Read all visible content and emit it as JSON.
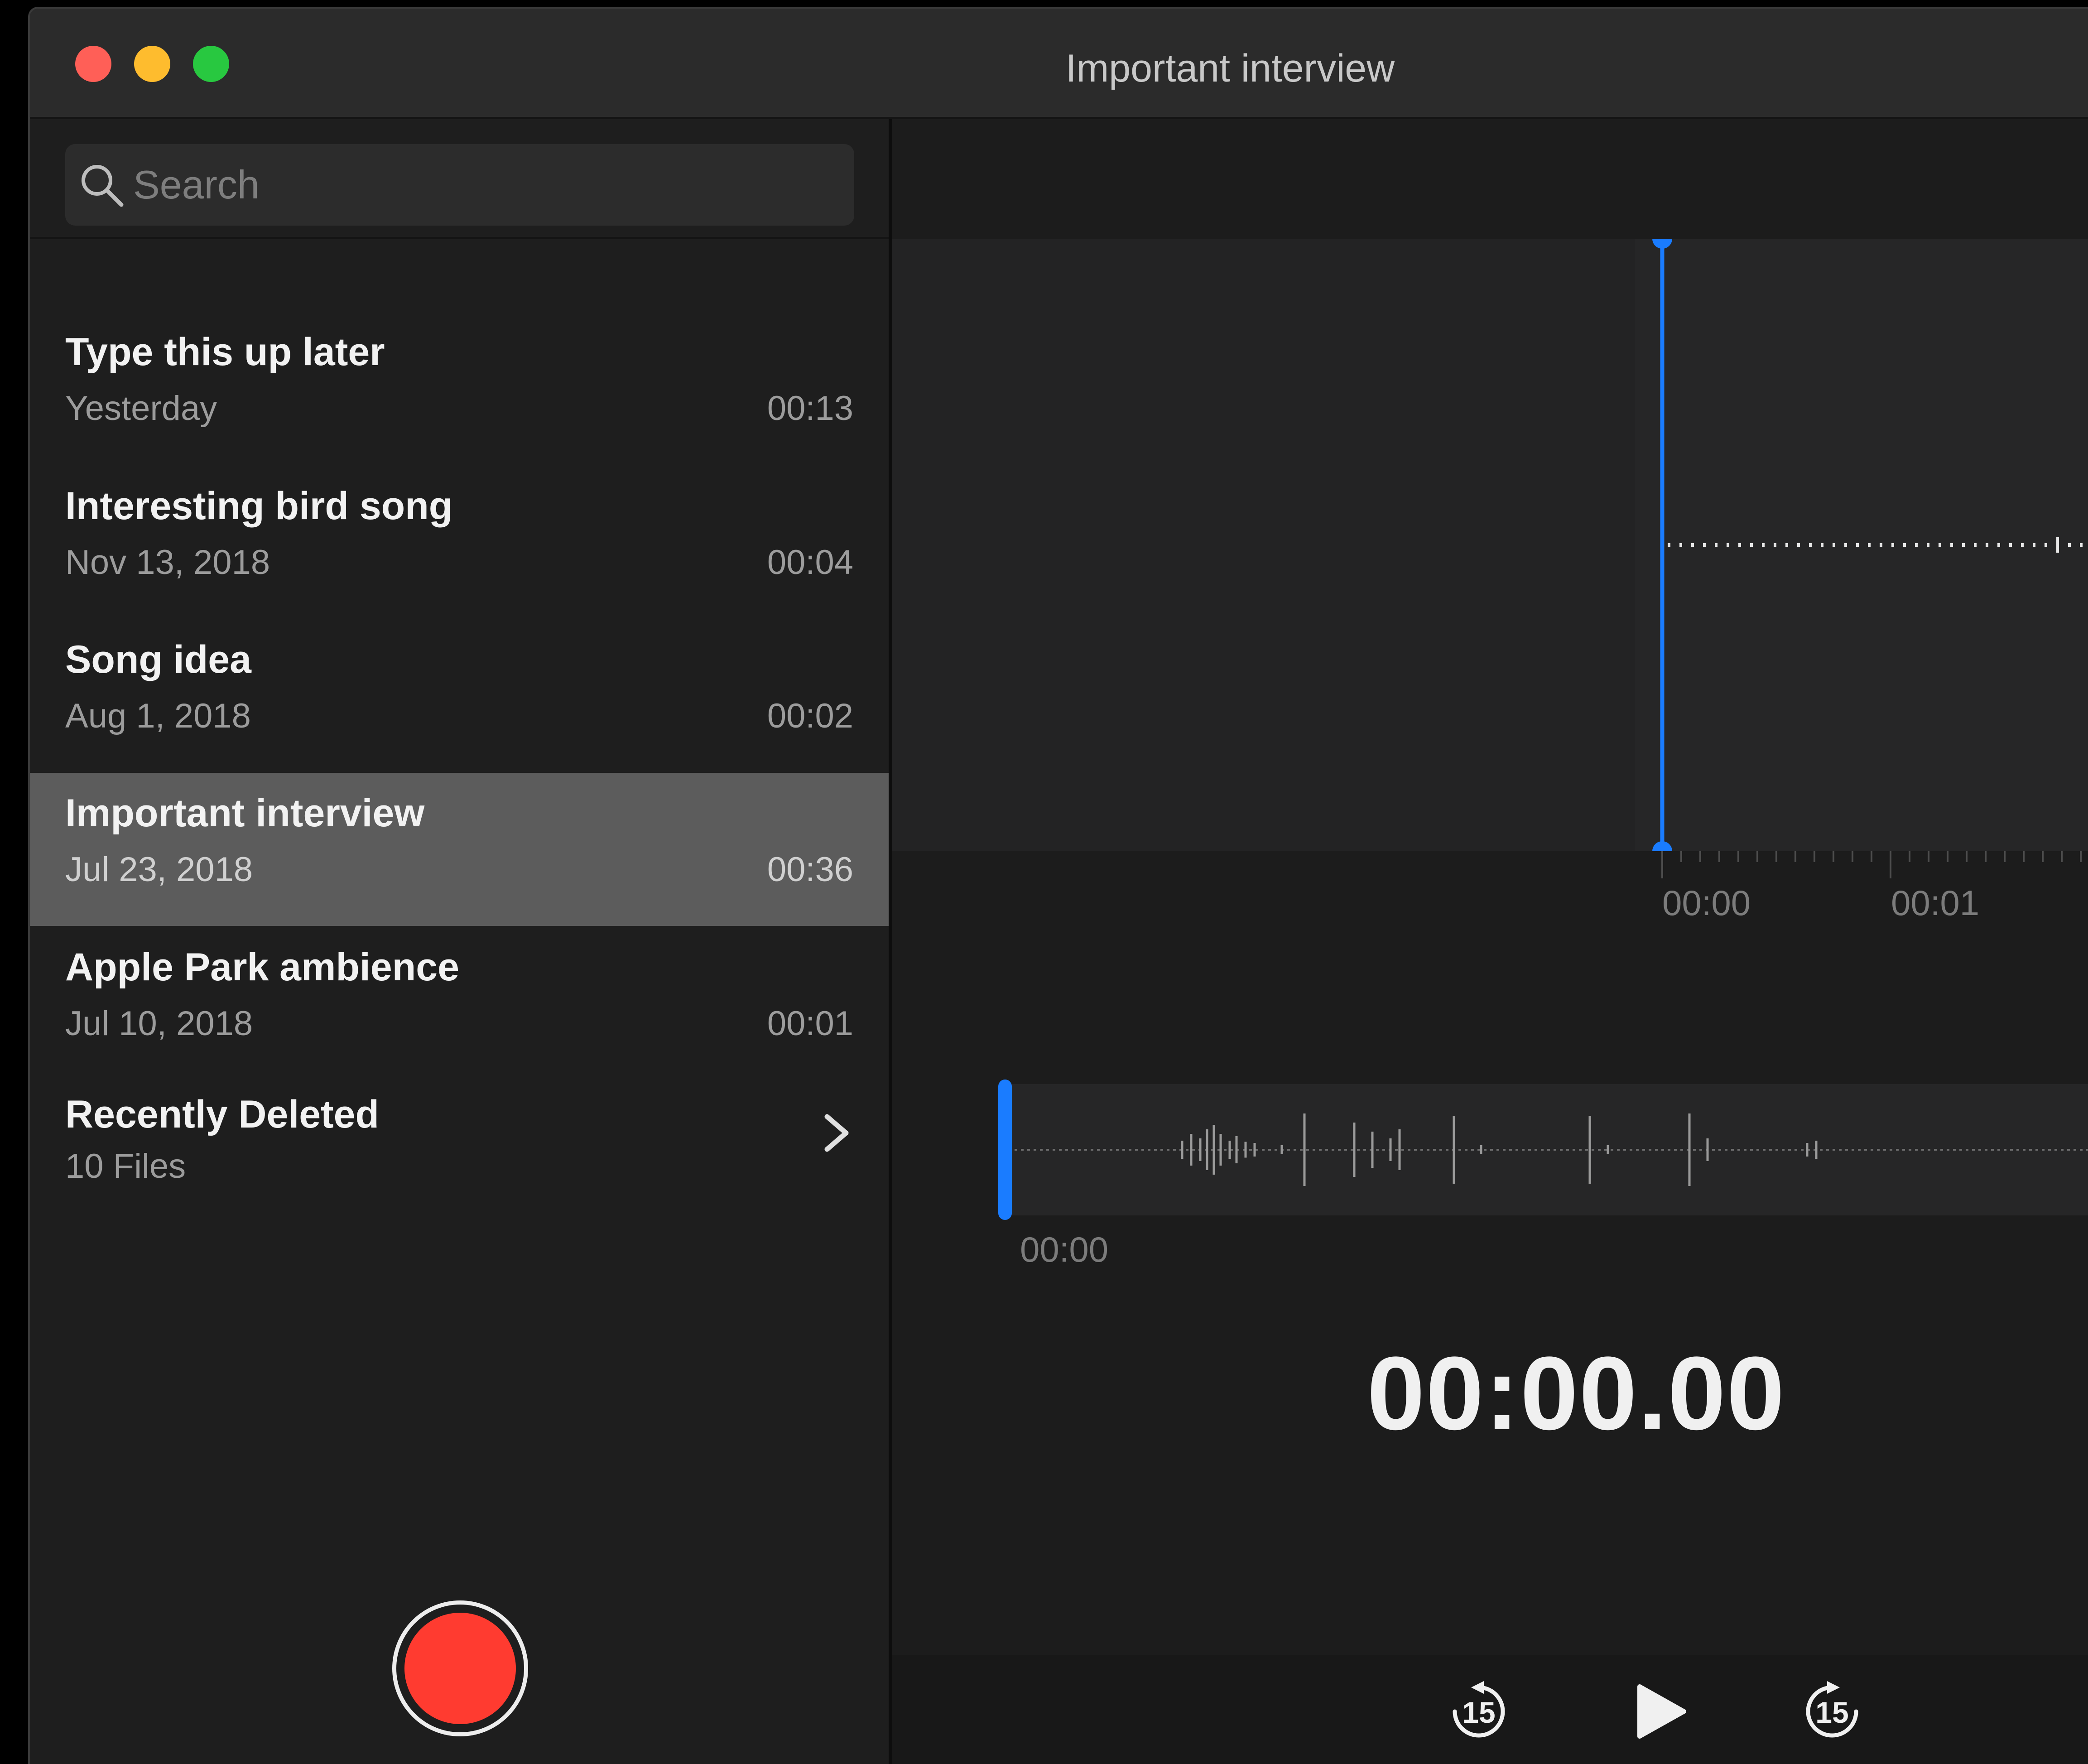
{
  "window": {
    "title": "Important interview",
    "traffic_lights": {
      "close": "#ff5f57",
      "minimize": "#febc2e",
      "zoom": "#28c840"
    }
  },
  "search": {
    "placeholder": "Search",
    "icon": "search-icon"
  },
  "recordings": [
    {
      "title": "Type this up later",
      "date": "Yesterday",
      "duration": "00:13",
      "selected": false
    },
    {
      "title": "Interesting bird song",
      "date": "Nov 13, 2018",
      "duration": "00:04",
      "selected": false
    },
    {
      "title": "Song idea",
      "date": "Aug 1, 2018",
      "duration": "00:02",
      "selected": false
    },
    {
      "title": "Important interview",
      "date": "Jul 23, 2018",
      "duration": "00:36",
      "selected": true
    },
    {
      "title": "Apple Park ambience",
      "date": "Jul 10, 2018",
      "duration": "00:01",
      "selected": false
    }
  ],
  "recently_deleted": {
    "title": "Recently Deleted",
    "count": "10 Files",
    "icon": "chevron-right-icon"
  },
  "record_button": {
    "icon": "record-icon",
    "color": "#ff3b30"
  },
  "waveform": {
    "playhead_color": "#1a7cff",
    "timeline_ticks": [
      "00:00",
      "00:01"
    ],
    "overview_start": "00:00"
  },
  "playback": {
    "current_time": "00:00.00",
    "skip_back_label": "15",
    "skip_forward_label": "15",
    "icons": [
      "skip-back-15-icon",
      "play-icon",
      "skip-forward-15-icon"
    ]
  }
}
